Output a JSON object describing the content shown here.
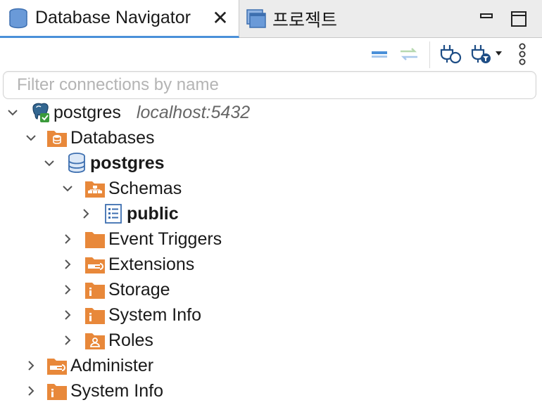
{
  "tabs": {
    "navigator": {
      "label": "Database Navigator",
      "close": "✕"
    },
    "project": {
      "label": "프로젝트"
    }
  },
  "filter": {
    "placeholder": "Filter connections by name",
    "value": ""
  },
  "colors": {
    "accent": "#4a90d9",
    "folder": "#e8883a",
    "db": "#4a78b8"
  },
  "tree": {
    "connection": {
      "name": "postgres",
      "host": "localhost:5432",
      "icon": "postgres-elephant-icon"
    },
    "databases": "Databases",
    "db_postgres": "postgres",
    "schemas": "Schemas",
    "public": "public",
    "event_triggers": "Event Triggers",
    "extensions": "Extensions",
    "storage": "Storage",
    "system_info_inner": "System Info",
    "roles": "Roles",
    "administer": "Administer",
    "system_info": "System Info"
  }
}
